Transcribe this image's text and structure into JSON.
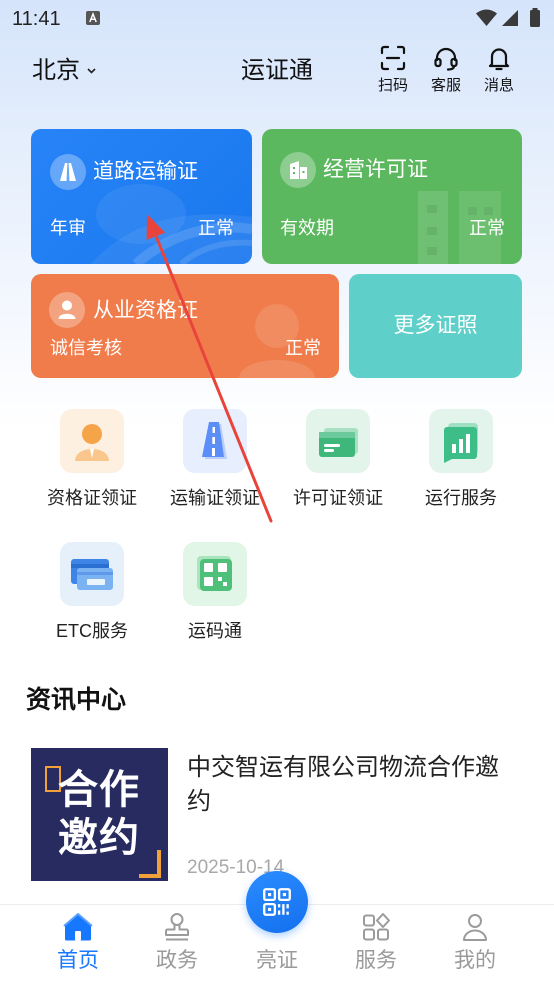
{
  "status_bar": {
    "time": "11:41",
    "icons": [
      "notification-a-icon",
      "wifi-icon",
      "signal-icon",
      "battery-icon"
    ]
  },
  "header": {
    "city": "北京",
    "title": "运证通",
    "actions": [
      {
        "label": "扫码",
        "icon": "scan-icon"
      },
      {
        "label": "客服",
        "icon": "headset-icon"
      },
      {
        "label": "消息",
        "icon": "bell-icon"
      }
    ]
  },
  "cards": {
    "road_transport": {
      "title": "道路运输证",
      "left": "年审",
      "right": "正常",
      "icon": "road-icon",
      "color": "#1a7cf7"
    },
    "business_license": {
      "title": "经营许可证",
      "left": "有效期",
      "right": "正常",
      "icon": "building-icon",
      "color": "#5cb85f"
    },
    "qualification": {
      "title": "从业资格证",
      "left": "诚信考核",
      "right": "正常",
      "icon": "person-icon",
      "color": "#f07c4b"
    },
    "more": {
      "title": "更多证照",
      "color": "#5fcfca"
    }
  },
  "services": [
    {
      "label": "资格证领证",
      "icon": "person-badge-icon"
    },
    {
      "label": "运输证领证",
      "icon": "road-icon"
    },
    {
      "label": "许可证领证",
      "icon": "license-card-icon"
    },
    {
      "label": "运行服务",
      "icon": "chart-document-icon"
    },
    {
      "label": "ETC服务",
      "icon": "etc-card-icon"
    },
    {
      "label": "运码通",
      "icon": "qr-code-icon"
    }
  ],
  "news": {
    "section_title": "资讯中心",
    "items": [
      {
        "title": "中交智运有限公司物流合作邀约",
        "date": "2025-10-14",
        "image_text_line1": "合作",
        "image_text_line2": "邀约"
      }
    ]
  },
  "bottom_nav": {
    "items": [
      {
        "label": "首页",
        "icon": "home-icon",
        "active": true
      },
      {
        "label": "政务",
        "icon": "stamp-icon",
        "active": false
      },
      {
        "label": "亮证",
        "icon": "qr-code-icon",
        "active": false
      },
      {
        "label": "服务",
        "icon": "grid-icon",
        "active": false
      },
      {
        "label": "我的",
        "icon": "user-icon",
        "active": false
      }
    ]
  },
  "colors": {
    "accent": "#1677ff",
    "inactive": "#9a9a9a",
    "annotation_arrow": "#e9443b"
  }
}
